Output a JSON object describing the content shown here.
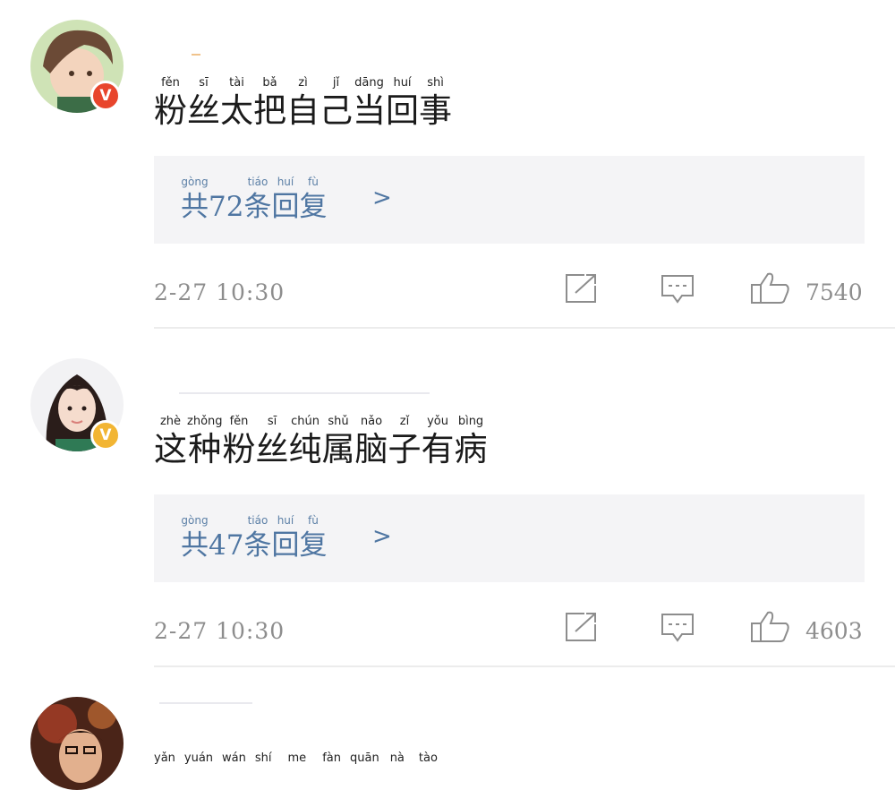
{
  "comments": [
    {
      "pinyin": [
        "fěn",
        "sī",
        "tài",
        "bǎ",
        "zì",
        "jǐ",
        "dāng",
        "huí",
        "shì"
      ],
      "chars": [
        "粉",
        "丝",
        "太",
        "把",
        "自",
        "己",
        "当",
        "回",
        "事"
      ],
      "badge": "V",
      "badge_color": "#e8452c",
      "reply_pinyin": [
        "gòng",
        "",
        "",
        "tiáo",
        "huí",
        "fù"
      ],
      "reply_chars": [
        "共",
        "7",
        "2",
        "条",
        "回",
        "复"
      ],
      "reply_chevron": ">",
      "time": "2-27  10:30",
      "likes": "7540"
    },
    {
      "pinyin": [
        "zhè",
        "zhǒng",
        "fěn",
        "sī",
        "chún",
        "shǔ",
        "nǎo",
        "zǐ",
        "yǒu",
        "bìng"
      ],
      "chars": [
        "这",
        "种",
        "粉",
        "丝",
        "纯",
        "属",
        "脑",
        "子",
        "有",
        "病"
      ],
      "badge": "V",
      "badge_color": "#f2b533",
      "reply_pinyin": [
        "gòng",
        "",
        "",
        "tiáo",
        "huí",
        "fù"
      ],
      "reply_chars": [
        "共",
        "4",
        "7",
        "条",
        "回",
        "复"
      ],
      "reply_chevron": ">",
      "time": "2-27  10:30",
      "likes": "4603"
    },
    {
      "pinyin": [
        "yǎn",
        "yuán",
        "wán",
        "shí",
        "me",
        "fàn",
        "quān",
        "nà",
        "tào"
      ]
    }
  ],
  "icons": [
    "share-icon",
    "comment-icon",
    "like-icon"
  ],
  "colors": {
    "link": "#4f76a2",
    "meta": "#8d8d8d",
    "reply_bg": "#f4f4f6"
  }
}
